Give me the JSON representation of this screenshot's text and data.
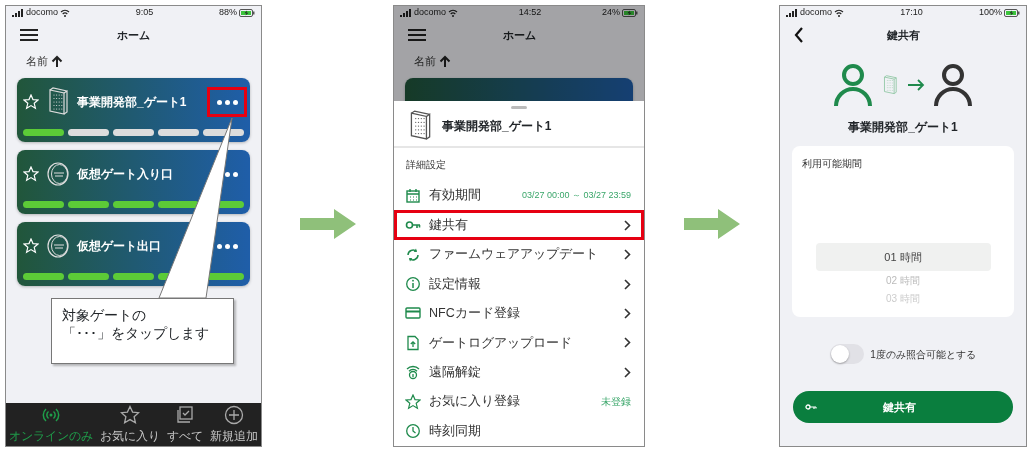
{
  "home_screen": {
    "status": {
      "carrier": "docomo",
      "time": "9:05",
      "battery": "88%"
    },
    "title": "ホーム",
    "sort_label": "名前",
    "gates": [
      {
        "name": "事業開発部_ゲート1",
        "kind": "panel",
        "segments": [
          {
            "on": true
          },
          {
            "on": false
          },
          {
            "on": false
          },
          {
            "on": false
          },
          {
            "on": false
          }
        ],
        "highlighted": true
      },
      {
        "name": "仮想ゲート入り口",
        "kind": "tag",
        "segments": [
          {
            "on": true
          },
          {
            "on": true
          },
          {
            "on": true
          },
          {
            "on": true
          },
          {
            "on": true
          }
        ],
        "highlighted": false
      },
      {
        "name": "仮想ゲート出口",
        "kind": "tag",
        "segments": [
          {
            "on": true
          },
          {
            "on": true
          },
          {
            "on": true
          },
          {
            "on": true
          },
          {
            "on": true
          }
        ],
        "highlighted": false
      }
    ],
    "callout": [
      "対象ゲートの",
      "「･･･」をタップします"
    ],
    "tab_bar": [
      {
        "label": "オンラインのみ",
        "kind": "online",
        "selected": true
      },
      {
        "label": "お気に入り",
        "kind": "star",
        "selected": false
      },
      {
        "label": "すべて",
        "kind": "all",
        "selected": false
      },
      {
        "label": "新規追加",
        "kind": "add",
        "selected": false
      }
    ]
  },
  "menu_screen": {
    "status": {
      "carrier": "docomo",
      "time": "14:52",
      "battery": "24%"
    },
    "title": "ホーム",
    "sort_label": "名前",
    "sheet": {
      "gate_name": "事業開発部_ゲート1",
      "section": "詳細設定",
      "items": [
        {
          "label": "有効期間",
          "kind": "calendar",
          "value": "03/27 00:00 ～ 03/27 23:59",
          "chevron": false,
          "highlighted": false
        },
        {
          "label": "鍵共有",
          "kind": "key",
          "chevron": true,
          "highlighted": true
        },
        {
          "label": "ファームウェアアップデート",
          "kind": "sync",
          "chevron": true,
          "highlighted": false
        },
        {
          "label": "設定情報",
          "kind": "info",
          "chevron": true,
          "highlighted": false
        },
        {
          "label": "NFCカード登録",
          "kind": "card",
          "chevron": true,
          "highlighted": false
        },
        {
          "label": "ゲートログアップロード",
          "kind": "upload",
          "chevron": true,
          "highlighted": false
        },
        {
          "label": "遠隔解錠",
          "kind": "remote",
          "chevron": true,
          "highlighted": false
        },
        {
          "label": "お気に入り登録",
          "kind": "star",
          "value": "未登録",
          "chevron": false,
          "highlighted": false
        },
        {
          "label": "時刻同期",
          "kind": "clock",
          "chevron": false,
          "highlighted": false
        }
      ]
    }
  },
  "share_screen": {
    "status": {
      "carrier": "docomo",
      "time": "17:10",
      "battery": "100%"
    },
    "title": "鍵共有",
    "gate_name": "事業開発部_ゲート1",
    "period_label": "利用可能期間",
    "options": [
      {
        "label": "01 時間",
        "selected": true
      },
      {
        "label": "02 時間",
        "selected": false
      },
      {
        "label": "03 時間",
        "selected": false
      }
    ],
    "toggle": {
      "label": "1度のみ照合可能とする",
      "on": false
    },
    "button": "鍵共有"
  }
}
